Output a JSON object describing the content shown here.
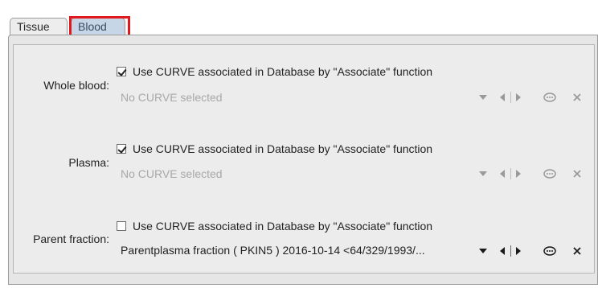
{
  "tabs": [
    {
      "label": "Tissue"
    },
    {
      "label": "Blood"
    }
  ],
  "rows": [
    {
      "label": "Whole blood:",
      "checkbox_label": "Use CURVE associated in Database by \"Associate\" function",
      "checked": true,
      "value": "No CURVE selected",
      "enabled": false
    },
    {
      "label": "Plasma:",
      "checkbox_label": "Use CURVE associated in Database by \"Associate\" function",
      "checked": true,
      "value": "No CURVE selected",
      "enabled": false
    },
    {
      "label": "Parent fraction:",
      "checkbox_label": "Use CURVE associated in Database by \"Associate\" function",
      "checked": false,
      "value": "Parentplasma fraction ( PKIN5 ) 2016-10-14 <64/329/1993/...",
      "enabled": true
    }
  ],
  "icons": [
    "dropdown-icon",
    "previous-icon",
    "next-icon",
    "details-icon",
    "clear-icon"
  ],
  "colors": {
    "highlight": "#e0191f",
    "selected_tab": "#c7d6e6",
    "disabled_text": "#a8a8a8"
  }
}
